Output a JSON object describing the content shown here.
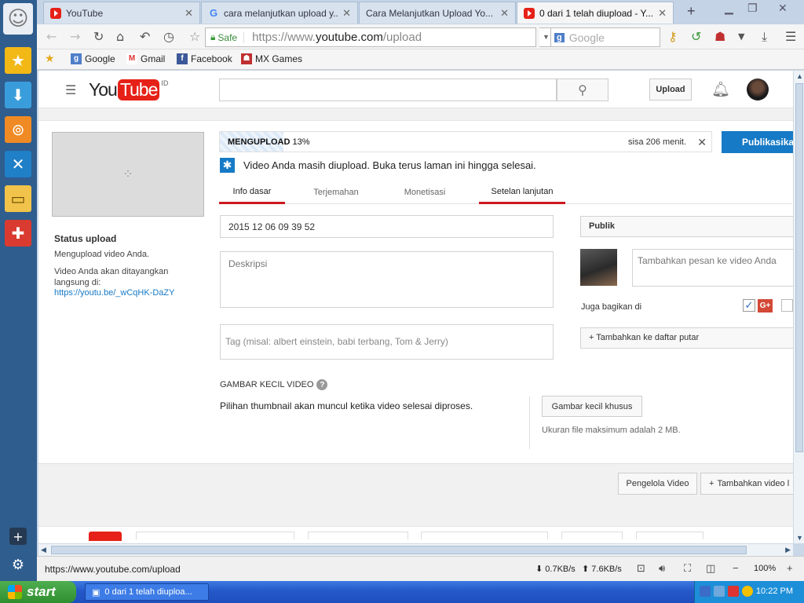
{
  "browser": {
    "tabs": [
      {
        "label": "YouTube",
        "icon": "youtube-favicon"
      },
      {
        "label": "cara melanjutkan upload y...",
        "icon": "google-favicon"
      },
      {
        "label": "Cara Melanjutkan Upload Yo...",
        "icon": "none"
      },
      {
        "label": "0 dari 1 telah diupload - Y...",
        "icon": "youtube-favicon",
        "active": true
      }
    ],
    "new_tab_symbol": "+",
    "url": {
      "safe_label": "Safe",
      "prefix": "https://www.",
      "host": "youtube.com",
      "path": "/upload"
    },
    "search_placeholder": "Google",
    "bookmarks": [
      {
        "label": "Google",
        "icon": "google-icon"
      },
      {
        "label": "Gmail",
        "icon": "gmail-icon"
      },
      {
        "label": "Facebook",
        "icon": "facebook-icon"
      },
      {
        "label": "MX Games",
        "icon": "mx-games-icon"
      }
    ],
    "status": {
      "url": "https://www.youtube.com/upload",
      "download": "0.7KB/s",
      "upload": "7.6KB/s",
      "zoom": "100%"
    }
  },
  "youtube": {
    "logo_you": "You",
    "logo_tube": "Tube",
    "region": "ID",
    "upload_button": "Upload",
    "upload": {
      "progress_label": "MENGUPLOAD",
      "progress_percent": "13%",
      "progress_value": 13,
      "remaining": "sisa 206 menit.",
      "publish_button": "Publikasikan",
      "notice": "Video Anda masih diupload. Buka terus laman ini hingga selesai.",
      "status_title": "Status upload",
      "status_message": "Mengupload video Anda.",
      "status_note": "Video Anda akan ditayangkan langsung di:",
      "video_link": "https://youtu.be/_wCqHK-DaZY",
      "tabs": [
        "Info dasar",
        "Terjemahan",
        "Monetisasi",
        "Setelan lanjutan"
      ],
      "title_value": "2015 12 06 09 39 52",
      "description_placeholder": "Deskripsi",
      "tag_placeholder": "Tag (misal: albert einstein, babi terbang, Tom & Jerry)",
      "privacy": "Publik",
      "message_placeholder": "Tambahkan pesan ke video Anda",
      "share_label": "Juga bagikan di",
      "gplus_label": "G+",
      "playlist_button": "+ Tambahkan ke daftar putar",
      "thumbnail_title": "GAMBAR KECIL VIDEO",
      "help_symbol": "?",
      "thumbnail_message": "Pilihan thumbnail akan muncul ketika video selesai diproses.",
      "custom_thumb_button": "Gambar kecil khusus",
      "max_size": "Ukuran file maksimum adalah 2 MB.",
      "video_manager_button": "Pengelola Video",
      "add_video_button": "Tambahkan video l"
    }
  },
  "taskbar": {
    "start": "start",
    "task_item": "0 dari 1 telah diuploa...",
    "clock": "10:22 PM"
  },
  "colors": {
    "youtube_red": "#e62117",
    "publish_blue": "#167ac6",
    "tab_underline": "#cc181e"
  }
}
